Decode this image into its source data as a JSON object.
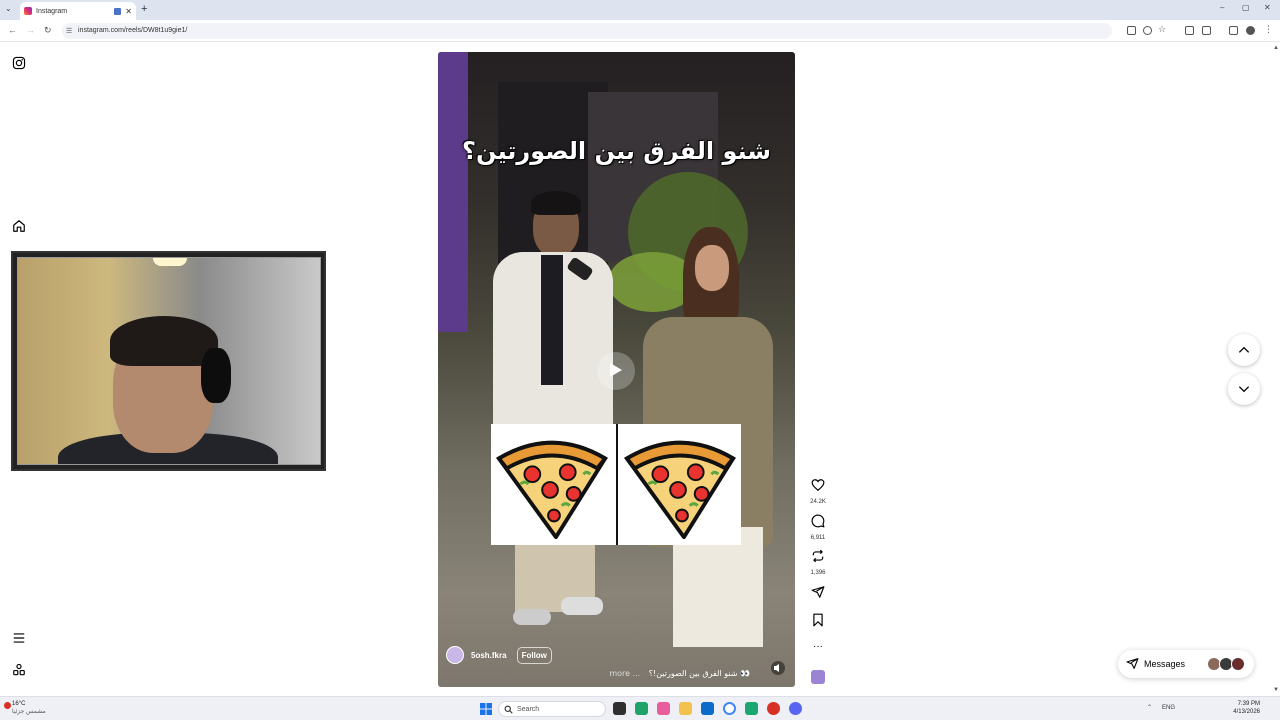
{
  "browser": {
    "tab_title": "Instagram",
    "tab_close": "✕",
    "new_tab": "+",
    "url": "instagram.com/reels/DW8t1u9gie1/",
    "window_controls": [
      "–",
      "▢",
      "✕"
    ]
  },
  "icons": {
    "instagram_logo": "instagram-icon",
    "home": "home-icon",
    "menu": "menu-icon",
    "more": "grid-icon",
    "like": "heart-icon",
    "comment": "comment-icon",
    "repost": "repost-icon",
    "share": "share-icon",
    "save": "bookmark-icon",
    "options": "more-icon",
    "next": "chevron-down-icon",
    "prev": "chevron-up-icon",
    "messages": "messages-icon"
  },
  "reel": {
    "title": "شنو الفرق بين الصورتين؟",
    "author": "5osh.fkra",
    "follow_label": "Follow",
    "caption": "شنو الفرق بين الصورتين!؟ 👀",
    "caption_more": "more ..."
  },
  "actions": {
    "likes": "24.2K",
    "comments": "6,911",
    "reposts": "1,396",
    "options": "···"
  },
  "messages": {
    "label": "Messages"
  },
  "taskbar": {
    "weather_temp": "16°C",
    "weather_desc": "مشمس جزئيا",
    "search_placeholder": "Search",
    "lang": "ENG",
    "time": "7:39 PM",
    "date": "4/13/2026"
  },
  "colors": {
    "accent": "#0095f6",
    "pizza_crust": "#f3b142",
    "pizza_pepperoni": "#e8332f"
  }
}
